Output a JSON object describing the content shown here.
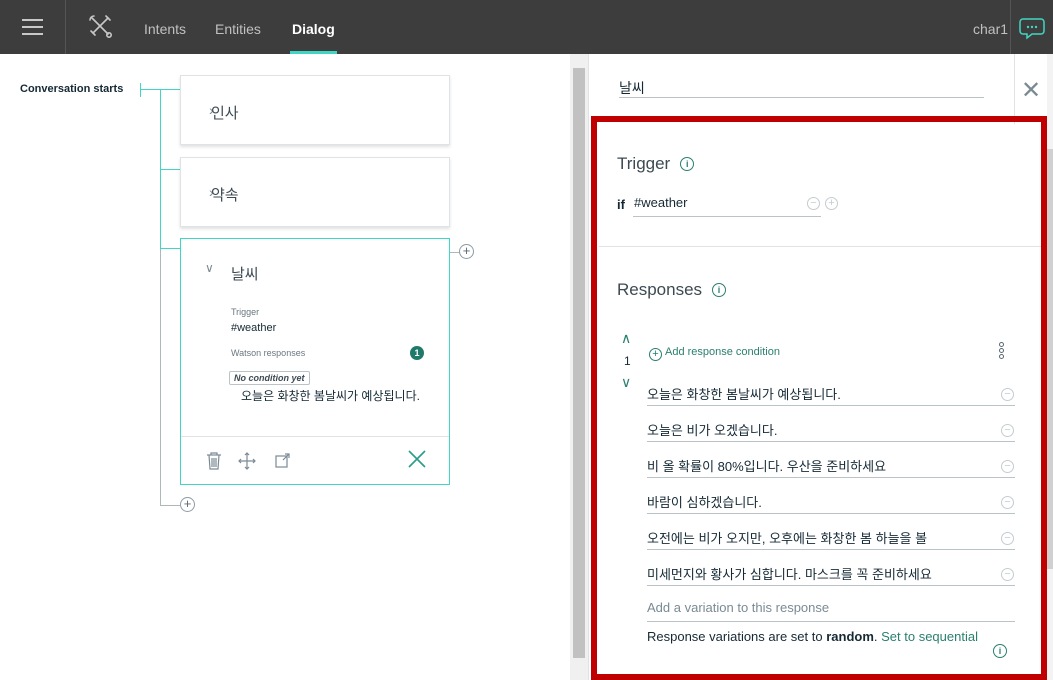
{
  "topbar": {
    "tabs": [
      {
        "label": "Intents"
      },
      {
        "label": "Entities"
      },
      {
        "label": "Dialog"
      }
    ],
    "user": "char1"
  },
  "canvas": {
    "conversation_label": "Conversation starts",
    "nodes": [
      {
        "title": "인사"
      },
      {
        "title": "약속"
      },
      {
        "title": "날씨",
        "trigger_label": "Trigger",
        "trigger_value": "#weather",
        "responses_label": "Watson responses",
        "responses_count": "1",
        "no_condition": "No condition yet",
        "response_preview": "오늘은 화창한 봄날씨가 예상됩니다."
      }
    ]
  },
  "panel": {
    "node_name": "날씨",
    "trigger": {
      "title": "Trigger",
      "if_label": "if",
      "condition": "#weather"
    },
    "responses": {
      "title": "Responses",
      "add_condition": "Add response condition",
      "condition_number": "1",
      "variations": [
        "오늘은 화창한 봄날씨가 예상됩니다.",
        "오늘은 비가 오겠습니다.",
        "비 올 확률이 80%입니다. 우산을 준비하세요",
        "바람이 심하겠습니다.",
        "오전에는 비가 오지만, 오후에는 화창한 봄 하늘을 볼",
        "미세먼지와 황사가 심합니다. 마스크를 꼭 준비하세요"
      ],
      "add_variation_placeholder": "Add a variation to this response",
      "variation_text_prefix": "Response variations are set to ",
      "variation_mode": "random",
      "variation_text_mid": ". ",
      "set_to_sequential": "Set to sequential"
    }
  },
  "colors": {
    "accent": "#41d6c3",
    "link": "#2a7f6f",
    "highlight": "#c00000",
    "topbar": "#3d3d3d"
  },
  "icons": [
    "hamburger-icon",
    "tools-icon",
    "chat-icon",
    "chevron-right-icon",
    "chevron-down-icon",
    "plus-circle-icon",
    "trash-icon",
    "move-icon",
    "jump-to-icon",
    "close-icon",
    "info-icon",
    "minus-circle-icon",
    "kebab-icon",
    "arrow-up-icon",
    "arrow-down-icon"
  ]
}
